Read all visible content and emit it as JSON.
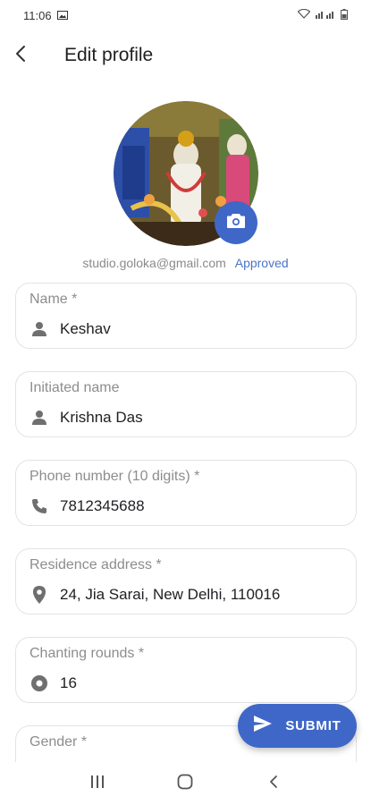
{
  "status_bar": {
    "time": "11:06"
  },
  "header": {
    "title": "Edit profile"
  },
  "profile": {
    "email": "studio.goloka@gmail.com",
    "status": "Approved"
  },
  "fields": [
    {
      "label": "Name *",
      "value": "Keshav",
      "icon": "person-icon"
    },
    {
      "label": "Initiated name",
      "value": "Krishna Das",
      "icon": "person-icon"
    },
    {
      "label": "Phone number (10 digits) *",
      "value": "7812345688",
      "icon": "phone-icon"
    },
    {
      "label": "Residence address *",
      "value": "24, Jia Sarai, New Delhi, 110016",
      "icon": "location-pin-icon"
    },
    {
      "label": "Chanting rounds *",
      "value": "16",
      "icon": "circle-dot-icon"
    },
    {
      "label": "Gender *",
      "value": "",
      "icon": ""
    }
  ],
  "submit": {
    "label": "SUBMIT",
    "icon": "send-icon"
  },
  "colors": {
    "accent": "#3f67c7",
    "approved": "#4a74c9"
  }
}
